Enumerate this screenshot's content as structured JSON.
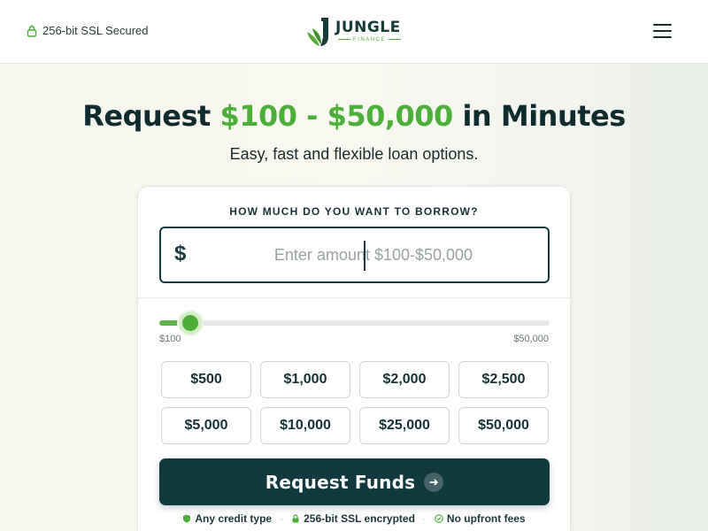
{
  "header": {
    "ssl_text": "256-bit SSL Secured",
    "brand_name": "JUNGLE",
    "brand_sub": "FINANCE",
    "menu_icon": "hamburger-icon"
  },
  "hero": {
    "title_prefix": "Request ",
    "title_highlight": "$100 - $50,000",
    "title_suffix": " in Minutes",
    "subtitle": "Easy, fast and flexible loan options."
  },
  "form": {
    "question": "HOW MUCH DO YOU WANT TO BORROW?",
    "currency_symbol": "$",
    "amount_placeholder": "Enter amount $100-$50,000",
    "amount_value": "",
    "slider": {
      "min_label": "$100",
      "max_label": "$50,000",
      "position_fraction": 0.08
    },
    "presets": [
      "$500",
      "$1,000",
      "$2,000",
      "$2,500",
      "$5,000",
      "$10,000",
      "$25,000",
      "$50,000"
    ],
    "submit_label": "Request Funds",
    "submit_icon": "arrow-right-icon"
  },
  "trust": {
    "items": [
      "Any credit type",
      "256-bit SSL encrypted",
      "No upfront fees"
    ],
    "separator": "·"
  },
  "colors": {
    "brand_dark": "#12393d",
    "brand_green": "#4caf3a",
    "slider_track": "#e7e7e5"
  }
}
